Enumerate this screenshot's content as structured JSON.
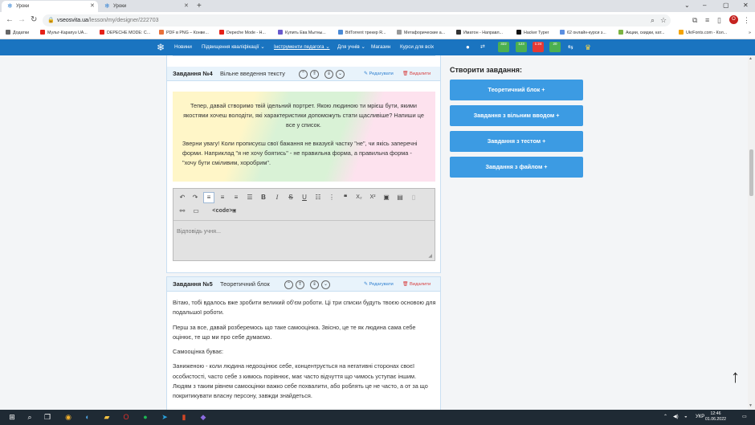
{
  "browser": {
    "tabs": [
      {
        "title": "Уроки",
        "active": true
      },
      {
        "title": "Уроки",
        "active": false
      }
    ],
    "new_tab": "+",
    "window_controls": [
      "⌄",
      "–",
      "▢",
      "✕"
    ],
    "url_domain": "vseosvita.ua",
    "url_path": "/lesson/my/designer/222703",
    "profile_initial": "O",
    "bookmarks": [
      "Додатки",
      "Мульт-Карапуз UA...",
      "DEPECHE MODE: C...",
      "PDF в PNG – Конве...",
      "Depeche Mode - H...",
      "Купить Ева Мытны...",
      "BitTorrent трекер R...",
      "Метафорические а...",
      "Иматон - Направл...",
      "Hacker Typer",
      "62 онлайн-курси з...",
      "Акции, скидки, кат...",
      "UkrFonts.com - Кол..."
    ]
  },
  "site_nav": {
    "items": [
      "Новини",
      "Підвищення кваліфікації ⌄",
      "Інструменти педагога ⌄",
      "Для учнів ⌄",
      "Магазин",
      "Курси для всіх"
    ],
    "badges": [
      "322",
      "123",
      "1:24",
      "20"
    ]
  },
  "task4": {
    "title": "Завдання №4",
    "type": "Вільне введення тексту",
    "edit": "Редагувати",
    "delete": "Видалити",
    "para1": "Тепер, давай створимо твій ідельний портрет. Якою людиною ти мрієш бути, якими якостями хочеш володіти, які характеристики допоможуть стати щасливіше? Напиши це все у список.",
    "para2": "Зверни увагу! Коли прописуєш свої бажання не вказуєй частку \"не\", чи якісь заперечні форми. Наприклад \"я не хочу боятись\" - не правильна форма, а правильна форма - \"хочу бути сміливим, хоробрим\".",
    "answer_placeholder": "Відповідь учня..."
  },
  "task5": {
    "title": "Завдання №5",
    "type": "Теоретичний блок",
    "edit": "Редагувати",
    "delete": "Видалити",
    "paragraphs": [
      "Вітаю, тобі вдалось вже зробити великий об'єм роботи. Ці три списки будуть твоєю основою для подальшої роботи.",
      "Перш за все, давай розберемось що таке самооцінка. Звісно, це те як людина сама себе оцінює, те що ми про себе думаємо.",
      "Самооцінка буває:",
      "Заниженою - коли людина недооцінює себе, концентрується на негативні сторонах своєї особистості, часто себе з кимось порівнює, має часто відчуття що чимось уступає іншим. Людям з таким рівнем самооцінки важко себе похвалити, або роблять це не часто, а от за що покритикувати власну персону, завжди знайдеться."
    ]
  },
  "sidebar": {
    "title": "Створити завдання:",
    "buttons": [
      "Теоретичний блок +",
      "Завдання з вільним вводом +",
      "Завдання з тестом +",
      "Завдання з файлом +"
    ]
  },
  "taskbar": {
    "lang": "УКР",
    "time": "12:46",
    "date": "01.06.2022"
  },
  "colors": {
    "site_nav": "#1a74c0",
    "side_button": "#3c9be3",
    "card_header": "#e8f3fb",
    "delete": "#d84040",
    "edit": "#2e7fd0"
  }
}
